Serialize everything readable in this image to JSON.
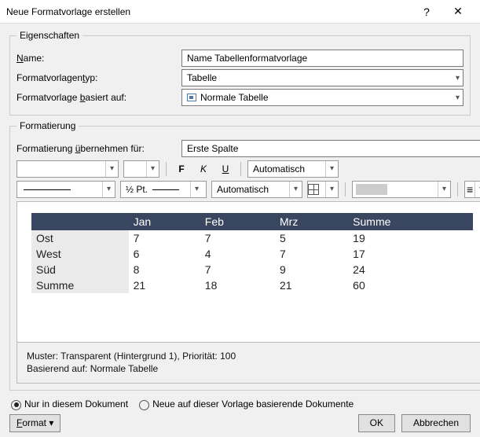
{
  "title": "Neue Formatvorlage erstellen",
  "groups": {
    "props": "Eigenschaften",
    "fmt": "Formatierung"
  },
  "labels": {
    "name": "Name:",
    "type": "Formatvorlagentyp:",
    "based": "Formatvorlage basiert auf:",
    "applyto": "Formatierung übernehmen für:"
  },
  "underline_idx": {
    "name": 0,
    "type": 14,
    "based": 15,
    "applyto": 14
  },
  "fields": {
    "name_value": "Name Tabellenformatvorlage",
    "type_value": "Tabelle",
    "based_value": "Normale Tabelle",
    "applyto_value": "Erste Spalte"
  },
  "toolbar": {
    "bold": "F",
    "italic": "K",
    "underline": "U",
    "autocolor": "Automatisch",
    "stroke": "½ Pt.",
    "bordercolor": "Automatisch"
  },
  "preview": {
    "headers": [
      "",
      "Jan",
      "Feb",
      "Mrz",
      "Summe"
    ],
    "rows": [
      [
        "Ost",
        "7",
        "7",
        "5",
        "19"
      ],
      [
        "West",
        "6",
        "4",
        "7",
        "17"
      ],
      [
        "Süd",
        "8",
        "7",
        "9",
        "24"
      ],
      [
        "Summe",
        "21",
        "18",
        "21",
        "60"
      ]
    ]
  },
  "description": {
    "line1": "Muster: Transparent (Hintergrund 1), Priorität: 100",
    "line2": "Basierend auf: Normale Tabelle"
  },
  "radios": {
    "thisdoc": "Nur in diesem Dokument",
    "template": "Neue auf dieser Vorlage basierende Dokumente"
  },
  "buttons": {
    "format": "Format",
    "ok": "OK",
    "cancel": "Abbrechen"
  }
}
